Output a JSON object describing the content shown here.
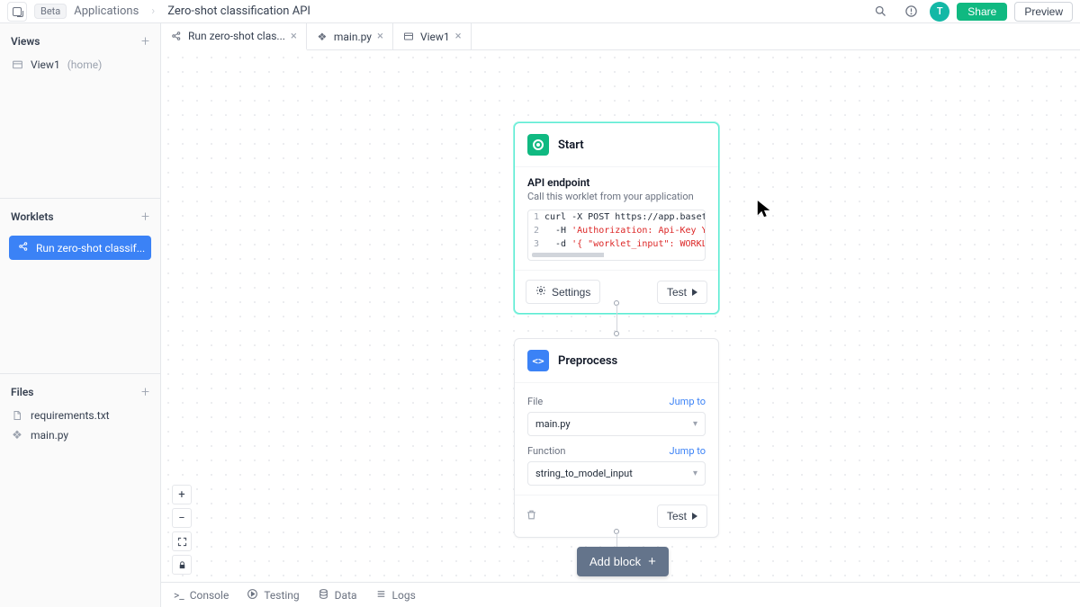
{
  "header": {
    "beta": "Beta",
    "crumb1": "Applications",
    "crumb2": "Zero-shot classification API",
    "avatar_letter": "T",
    "share": "Share",
    "preview": "Preview"
  },
  "sidebar": {
    "views": {
      "title": "Views",
      "items": [
        {
          "label": "View1",
          "hint": "(home)"
        }
      ]
    },
    "worklets": {
      "title": "Worklets",
      "items": [
        {
          "label": "Run zero-shot classif..."
        }
      ]
    },
    "files": {
      "title": "Files",
      "items": [
        {
          "name": "requirements.txt",
          "kind": "txt"
        },
        {
          "name": "main.py",
          "kind": "py"
        }
      ]
    }
  },
  "tabs": [
    {
      "label": "Run zero-shot clas...",
      "icon": "share",
      "closable": true
    },
    {
      "label": "main.py",
      "icon": "py",
      "closable": true
    },
    {
      "label": "View1",
      "icon": "view",
      "closable": true
    }
  ],
  "start_node": {
    "title": "Start",
    "section_label": "API endpoint",
    "section_sub": "Call this worklet from your application",
    "code": {
      "l1a": "curl -X POST https://app.baseten",
      "l2a": "  -H ",
      "l2b": "'Authorization: Api-Key YOUR",
      "l3a": "  -d ",
      "l3b": "'{ \"worklet_input\": WORKLET_"
    },
    "settings": "Settings",
    "test": "Test"
  },
  "pre_node": {
    "title": "Preprocess",
    "file_label": "File",
    "file_value": "main.py",
    "func_label": "Function",
    "func_value": "string_to_model_input",
    "jump": "Jump to",
    "test": "Test"
  },
  "addblock": "Add block",
  "bottombar": {
    "console": "Console",
    "testing": "Testing",
    "data": "Data",
    "logs": "Logs"
  }
}
